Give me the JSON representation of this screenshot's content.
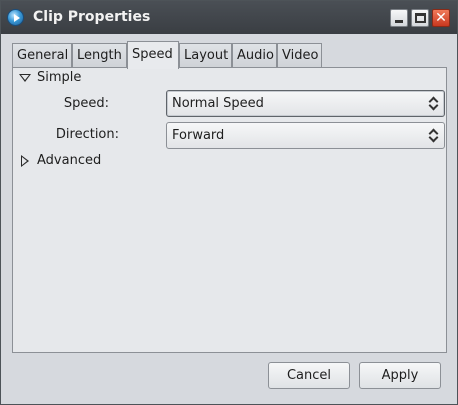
{
  "window": {
    "title": "Clip Properties",
    "controls": {
      "minimize": "minimize-icon",
      "maximize": "maximize-icon",
      "close": "close-icon",
      "close_glyph": "✕"
    }
  },
  "tabs": [
    {
      "label": "General",
      "active": false
    },
    {
      "label": "Length",
      "active": false
    },
    {
      "label": "Speed",
      "active": true
    },
    {
      "label": "Layout",
      "active": false
    },
    {
      "label": "Audio",
      "active": false
    },
    {
      "label": "Video",
      "active": false
    }
  ],
  "simple": {
    "label": "Simple",
    "expanded": true,
    "speed": {
      "label": "Speed:",
      "value": "Normal Speed"
    },
    "direction": {
      "label": "Direction:",
      "value": "Forward"
    }
  },
  "advanced": {
    "label": "Advanced",
    "expanded": false
  },
  "buttons": {
    "cancel": "Cancel",
    "apply": "Apply"
  }
}
